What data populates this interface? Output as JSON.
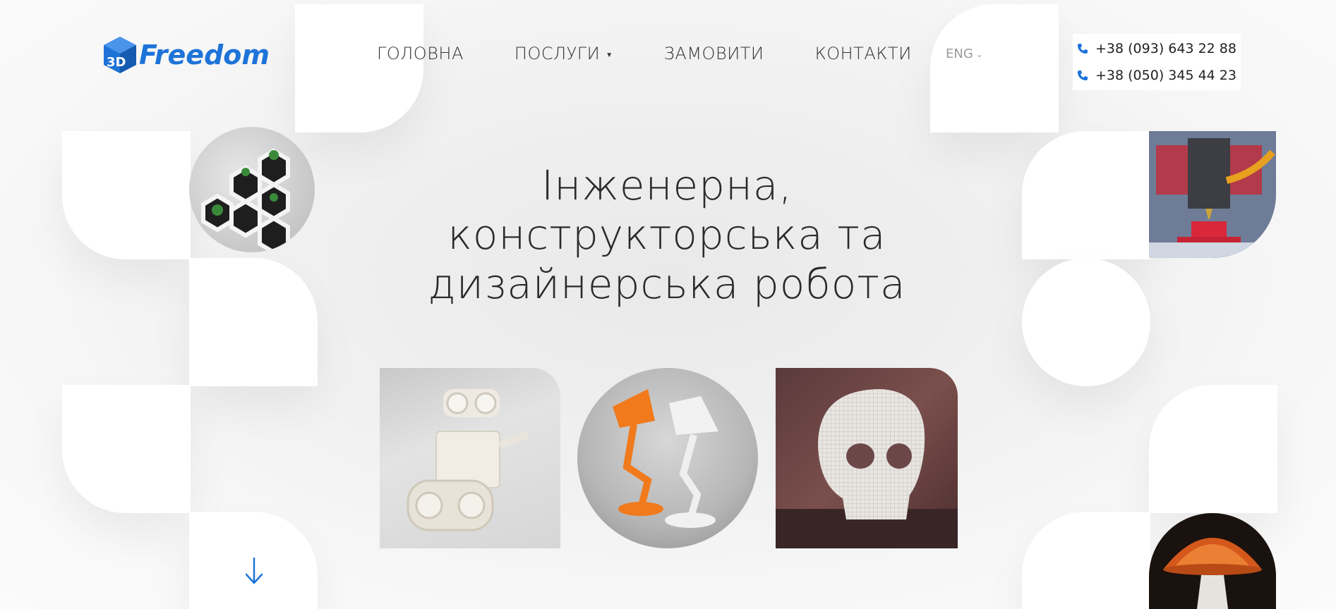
{
  "brand": {
    "logo_prefix": "3D",
    "logo_text": "Freedom"
  },
  "nav": {
    "items": [
      {
        "label": "ГОЛОВНА"
      },
      {
        "label": "ПОСЛУГИ",
        "has_dropdown": true
      },
      {
        "label": "ЗАМОВИТИ"
      },
      {
        "label": "КОНТАКТИ"
      }
    ]
  },
  "language": {
    "current": "ENG"
  },
  "contacts": {
    "phones": [
      "+38 (093) 643 22 88",
      "+38 (050) 345 44 23"
    ]
  },
  "hero": {
    "title_lines": [
      "Інженерна,",
      "конструкторська та",
      "дизайнерська робота"
    ]
  },
  "images": {
    "robot": "wall-e 3D print",
    "lamps": "luxo lamps 3D print",
    "skull": "lattice skull 3D print",
    "plants": "hexagon planters",
    "printer": "3D printer nozzle",
    "mushroom": "mushroom lamp"
  },
  "colors": {
    "accent": "#1e73d8",
    "text": "#2a2a2a",
    "muted": "#9a9a9a"
  },
  "icons": {
    "scroll": "arrow-down-icon",
    "phone": "phone-icon",
    "lang": "chevron-down-icon"
  }
}
